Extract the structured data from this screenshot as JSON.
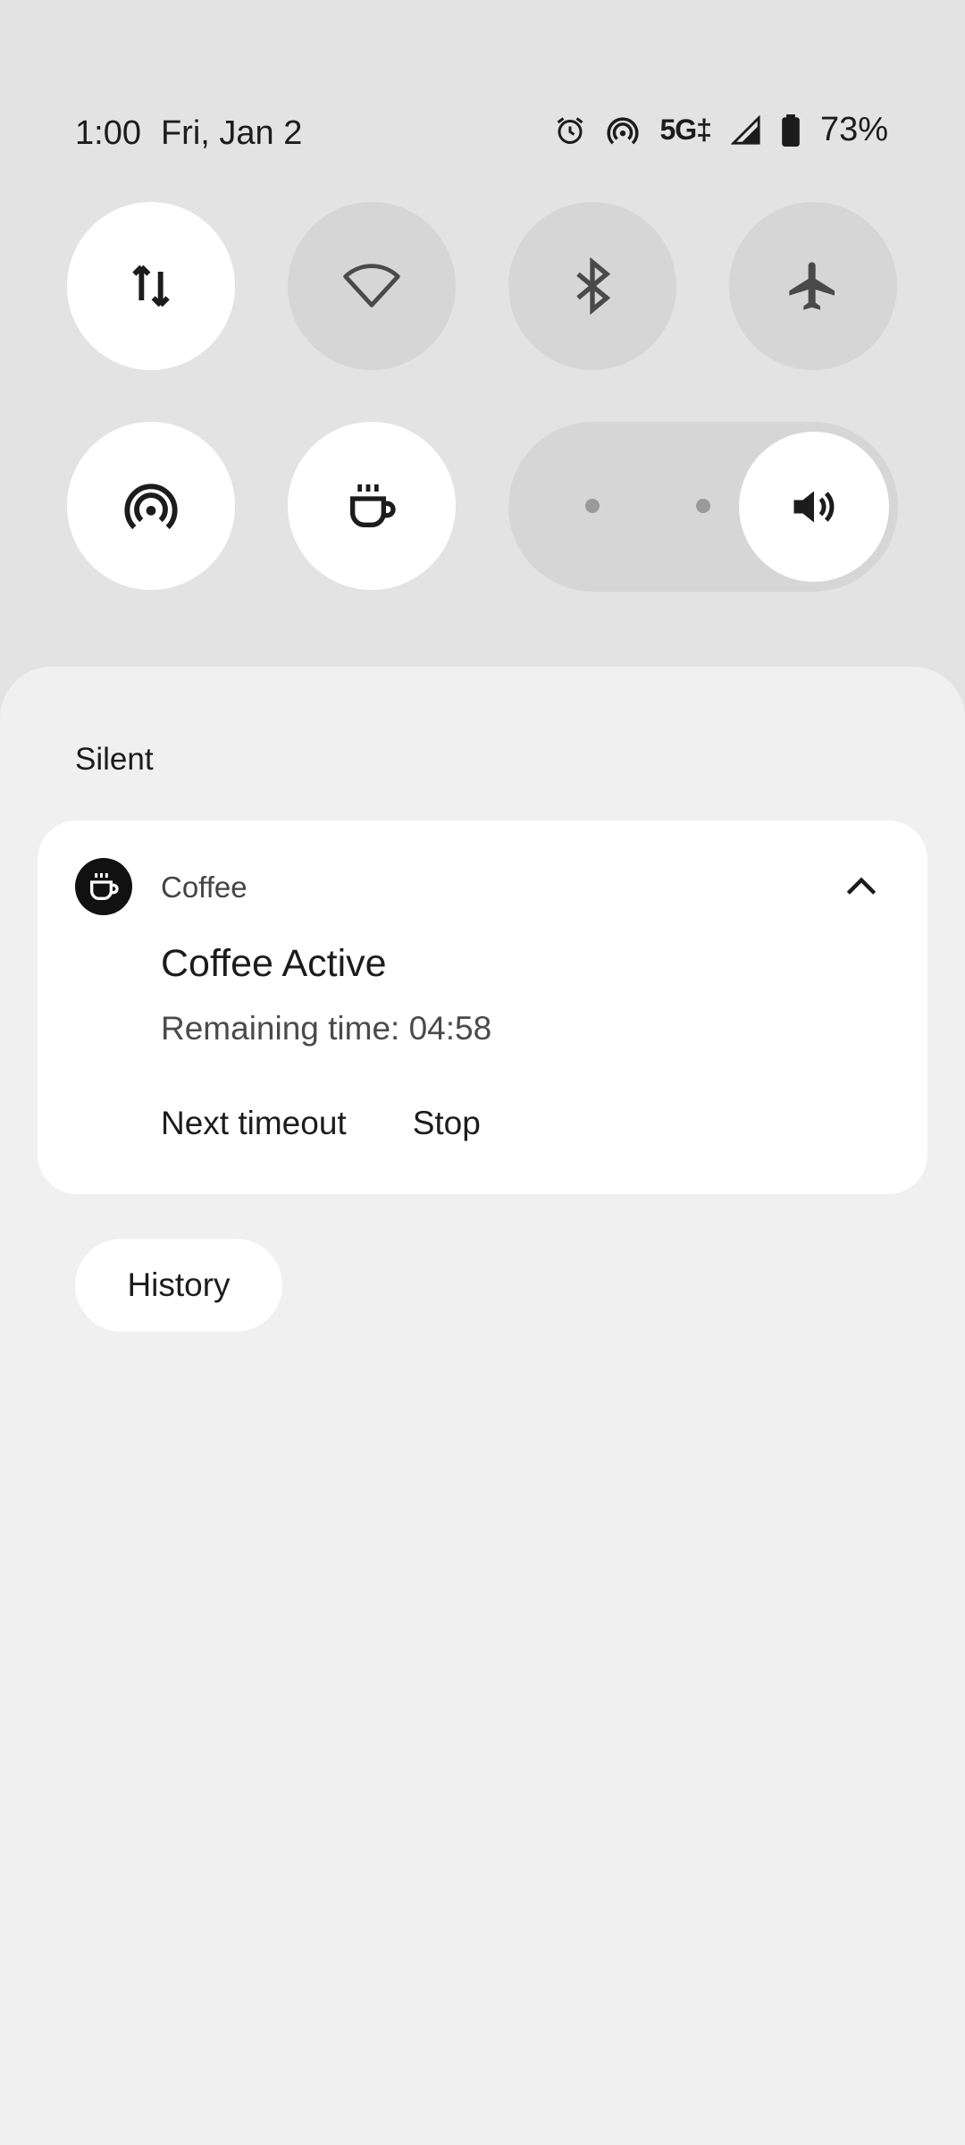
{
  "status_bar": {
    "time": "1:00",
    "date": "Fri, Jan 2",
    "network": "5G‡",
    "battery_percent": "73%",
    "icons": [
      "alarm-icon",
      "hotspot-icon",
      "signal-icon",
      "battery-icon"
    ]
  },
  "quick_tiles": [
    {
      "name": "mobile-data",
      "icon": "data-transfer-icon",
      "active": true
    },
    {
      "name": "wifi",
      "icon": "wifi-icon",
      "active": false
    },
    {
      "name": "bluetooth",
      "icon": "bluetooth-icon",
      "active": false
    },
    {
      "name": "airplane-mode",
      "icon": "airplane-icon",
      "active": false
    },
    {
      "name": "hotspot",
      "icon": "hotspot-icon",
      "active": true
    },
    {
      "name": "coffee",
      "icon": "coffee-cup-icon",
      "active": true
    }
  ],
  "volume": {
    "icon": "volume-icon",
    "level": "sound"
  },
  "notifications": {
    "section_label": "Silent",
    "card": {
      "app_name": "Coffee",
      "title": "Coffee Active",
      "text": "Remaining time: 04:58",
      "actions": [
        "Next timeout",
        "Stop"
      ]
    },
    "history_label": "History"
  }
}
